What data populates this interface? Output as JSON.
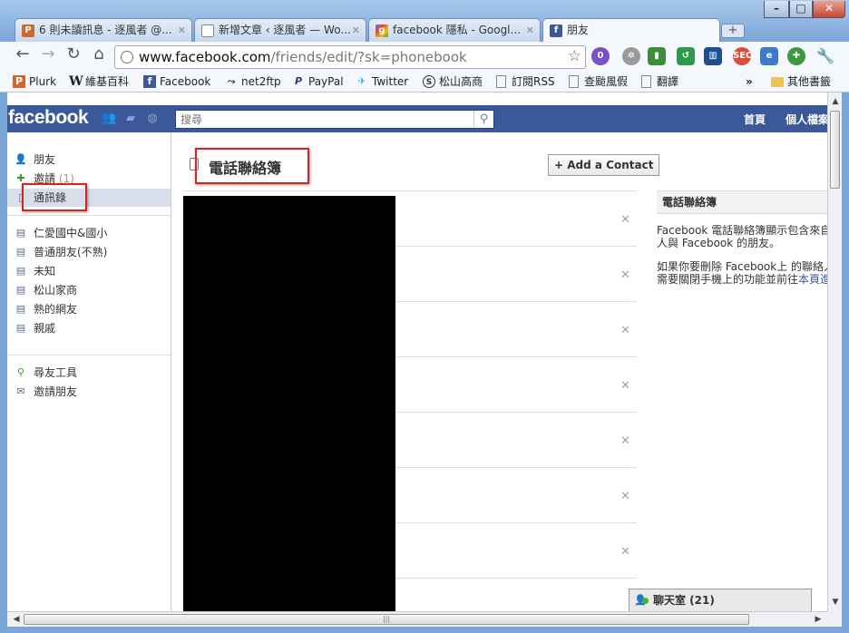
{
  "window": {
    "minimize": "–",
    "maximize": "□",
    "close": "✕"
  },
  "tabs": [
    {
      "title": "6 則未讀訊息 - 逐風者 @...",
      "icon": "plurk-icon",
      "close": "✕"
    },
    {
      "title": "新增文章 ‹ 逐風者 — Wo...",
      "icon": "page-icon",
      "close": "✕"
    },
    {
      "title": "facebook 隱私 - Googl...",
      "icon": "google-icon",
      "close": "✕"
    },
    {
      "title": "朋友",
      "icon": "facebook-icon",
      "close": ""
    }
  ],
  "newtab_label": "+",
  "address": {
    "host": "www.facebook.com",
    "path": "/friends/edit/?sk=phonebook"
  },
  "bookmarks": [
    {
      "label": "Plurk",
      "icon": "plurk-icon"
    },
    {
      "label": "維基百科",
      "icon": "wikipedia-icon"
    },
    {
      "label": "Facebook",
      "icon": "facebook-icon"
    },
    {
      "label": "net2ftp",
      "icon": "ftp-icon"
    },
    {
      "label": "PayPal",
      "icon": "paypal-icon"
    },
    {
      "label": "Twitter",
      "icon": "twitter-icon"
    },
    {
      "label": "松山高商",
      "icon": "school-icon"
    },
    {
      "label": "訂閱RSS",
      "icon": "page-icon"
    },
    {
      "label": "查颱風假",
      "icon": "page-icon"
    },
    {
      "label": "翻譯",
      "icon": "page-icon"
    }
  ],
  "bookmarks_overflow": "»",
  "other_bookmarks": "其他書籤",
  "facebook": {
    "logo": "facebook",
    "search_placeholder": "搜尋",
    "top_links": {
      "home": "首頁",
      "profile": "個人檔案"
    },
    "left_nav": {
      "primary": [
        {
          "label": "朋友",
          "count": ""
        },
        {
          "label": "邀請",
          "count": "(1)"
        },
        {
          "label": "通訊錄",
          "count": ""
        }
      ],
      "lists": [
        "仁愛國中&國小",
        "普通朋友(不熟)",
        "未知",
        "松山家商",
        "熟的網友",
        "親戚"
      ],
      "tools": [
        "尋友工具",
        "邀請朋友"
      ]
    },
    "page_title": "電話聯絡簿",
    "add_contact": "+ Add a Contact",
    "contacts": [
      {
        "remove": "✕"
      },
      {
        "remove": "✕"
      },
      {
        "remove": "✕"
      },
      {
        "remove": "✕"
      },
      {
        "remove": "✕"
      },
      {
        "remove": "✕"
      },
      {
        "remove": "✕"
      },
      {
        "remove": ""
      }
    ],
    "sidebar": {
      "header": "電話聯絡簿",
      "line1": "Facebook 電話聯絡簿顯示包含來自",
      "line2": "人與 Facebook 的朋友。",
      "line3": "如果你要刪除 Facebook上 的聯絡人",
      "line4_prefix": "需要關閉手機上的功能並前往",
      "line4_link": "本頁進"
    },
    "chat": {
      "label": "聊天室 (21)"
    }
  },
  "colors": {
    "facebook_blue": "#3b5998",
    "annotation_red": "#e02020",
    "nav_selected": "#d8dfea"
  }
}
